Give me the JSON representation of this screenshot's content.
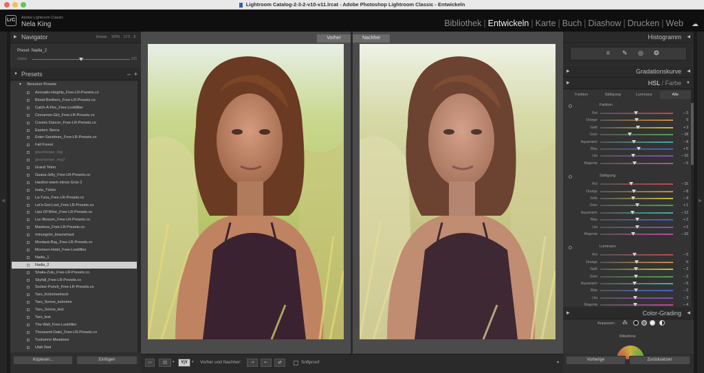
{
  "window": {
    "title": "Lightroom Catalog-2-3-2-v10-v11.lrcat - Adobe Photoshop Lightroom Classic - Entwickeln"
  },
  "identity": {
    "logo": "LrC",
    "app_name": "Adobe Lightroom Classic",
    "user": "Nela King"
  },
  "modules": {
    "items": [
      "Bibliothek",
      "Entwickeln",
      "Karte",
      "Buch",
      "Diashow",
      "Drucken",
      "Web"
    ],
    "active": "Entwickeln",
    "separator": "|"
  },
  "navigator": {
    "title": "Navigator",
    "zoom_options": [
      "Einpas.",
      "100%",
      "12.5",
      "$"
    ],
    "preset_label": "Preset: Nadia_2",
    "strength_label": "Stärke",
    "strength_value": "100",
    "strength_level": 0.5
  },
  "presets": {
    "title": "Presets",
    "group": "Benutzer-Presets",
    "items": [
      {
        "name": "Avocado-Heights_Free-LR-Presets.co",
        "style": "normal"
      },
      {
        "name": "Blood-Brothers_Free-LR-Presets.co",
        "style": "normal"
      },
      {
        "name": "Catch-A-Fire_Free-Lookfilter",
        "style": "normal"
      },
      {
        "name": "Cinnamon-Girl_Free-LR-Presets.co",
        "style": "normal"
      },
      {
        "name": "Cosmic Dancer_Free-LR-Presets.co",
        "style": "normal"
      },
      {
        "name": "Eastern Sierra",
        "style": "normal"
      },
      {
        "name": "Enter-Sandman_Free-LR-Presets.co",
        "style": "normal"
      },
      {
        "name": "Fall Forest",
        "style": "normal"
      },
      {
        "name": "gluehlampe_img",
        "style": "italic"
      },
      {
        "name": "gluehlampe_img2",
        "style": "italic"
      },
      {
        "name": "Grand Teton",
        "style": "normal"
      },
      {
        "name": "Guava-Jelly_Free-LR-Presets.co",
        "style": "normal"
      },
      {
        "name": "Haulton warm minus Grün 2",
        "style": "normal"
      },
      {
        "name": "Insta_Türkis",
        "style": "normal"
      },
      {
        "name": "La-Tuna_Free-LR-Presets.co",
        "style": "normal"
      },
      {
        "name": "Let's-Get-Lost_Free-LR-Presets.co",
        "style": "normal"
      },
      {
        "name": "Lips-Of-Wine_Free-LR-Presets.co",
        "style": "normal"
      },
      {
        "name": "Luc-Besson_Free-LR-Presets.co",
        "style": "normal"
      },
      {
        "name": "Mantova_Free-LR-Presets.co",
        "style": "normal"
      },
      {
        "name": "minusgrün_braunehaut",
        "style": "normal"
      },
      {
        "name": "Montauk-Bay_Free-LR-Presets.co",
        "style": "normal"
      },
      {
        "name": "Morrison-Hotel_Free-Lookfilter",
        "style": "normal"
      },
      {
        "name": "Nadia_1",
        "style": "normal"
      },
      {
        "name": "Nadia_2",
        "style": "selected"
      },
      {
        "name": "Shaka-Zulu_Free-LR-Presets.co",
        "style": "normal"
      },
      {
        "name": "Skyfall_Free-LR-Presets.co",
        "style": "normal"
      },
      {
        "name": "Sucker-Punch_Free-LR-Presets.co",
        "style": "normal"
      },
      {
        "name": "Taro_Kolorimetrisch",
        "style": "normal"
      },
      {
        "name": "Taro_Sonne_kolorime",
        "style": "normal"
      },
      {
        "name": "Taro_Sonne_test",
        "style": "normal"
      },
      {
        "name": "Taro_test",
        "style": "normal"
      },
      {
        "name": "The-Wall_Free-Lookfilter",
        "style": "normal"
      },
      {
        "name": "Thousand-Oaks_Free-LR-Presets.co",
        "style": "normal"
      },
      {
        "name": "Tuolumne Meadows",
        "style": "normal"
      },
      {
        "name": "Utah Red",
        "style": "normal"
      }
    ]
  },
  "left_buttons": {
    "copy": "Kopieren...",
    "paste": "Einfügen"
  },
  "view": {
    "before_label": "Vorher",
    "after_label": "Nachher"
  },
  "toolbar": {
    "compare_label": "Vorher und Nachher:",
    "yy_label": "Y|Y",
    "softproof_label": "Softproof"
  },
  "right_panel": {
    "histogram_title": "Histogramm",
    "tone_curve_title": "Gradationskurve",
    "hsl_title": "HSL",
    "hsl_sep": "/",
    "color_title": "Farbe",
    "tabs": [
      "Farbton",
      "Sättigung",
      "Luminanz",
      "Alle"
    ],
    "active_tab": "Alle",
    "sections": [
      {
        "title": "Farbton",
        "rows": [
          {
            "label": "Rot",
            "value": "– 2",
            "level": -2
          },
          {
            "label": "Orange",
            "value": "0",
            "level": 0
          },
          {
            "label": "Gelb",
            "value": "+ 3",
            "level": 3
          },
          {
            "label": "Grün",
            "value": "– 18",
            "level": -18
          },
          {
            "label": "Aquamarin",
            "value": "– 8",
            "level": -8
          },
          {
            "label": "Blau",
            "value": "+ 5",
            "level": 5
          },
          {
            "label": "Lila",
            "value": "– 10",
            "level": -10
          },
          {
            "label": "Magenta",
            "value": "– 5",
            "level": -5
          }
        ]
      },
      {
        "title": "Sättigung",
        "rows": [
          {
            "label": "Rot",
            "value": "– 15",
            "level": -15
          },
          {
            "label": "Orange",
            "value": "– 8",
            "level": -8
          },
          {
            "label": "Gelb",
            "value": "– 9",
            "level": -9
          },
          {
            "label": "Grün",
            "value": "+ 1",
            "level": 1
          },
          {
            "label": "Aquamarin",
            "value": "– 12",
            "level": -12
          },
          {
            "label": "Blau",
            "value": "+ 2",
            "level": 2
          },
          {
            "label": "Lila",
            "value": "+ 2",
            "level": 2
          },
          {
            "label": "Magenta",
            "value": "– 10",
            "level": -10
          }
        ]
      },
      {
        "title": "Luminanz",
        "rows": [
          {
            "label": "Rot",
            "value": "– 5",
            "level": -5
          },
          {
            "label": "Orange",
            "value": "0",
            "level": 0
          },
          {
            "label": "Gelb",
            "value": "– 2",
            "level": -2
          },
          {
            "label": "Grün",
            "value": "– 2",
            "level": -2
          },
          {
            "label": "Aquamarin",
            "value": "– 5",
            "level": -5
          },
          {
            "label": "Blau",
            "value": "– 2",
            "level": -2
          },
          {
            "label": "Lila",
            "value": "– 3",
            "level": -3
          },
          {
            "label": "Magenta",
            "value": "– 4",
            "level": -4
          }
        ]
      }
    ],
    "color_grading_title": "Color-Grading",
    "adjust_label": "Anpassen:",
    "midtones_label": "Mitteltöne",
    "previous_button": "Vorherige",
    "reset_button": "Zurücksetzen"
  },
  "colors": {
    "accent_selected": "#d0d0d0",
    "track_colors": {
      "Rot": "#c8464e",
      "Orange": "#d28a3a",
      "Gelb": "#c9be3c",
      "Grün": "#4da54b",
      "Aquamarin": "#3eb3a7",
      "Blau": "#3f66cf",
      "Lila": "#8b4cc4",
      "Magenta": "#c447a8"
    }
  }
}
